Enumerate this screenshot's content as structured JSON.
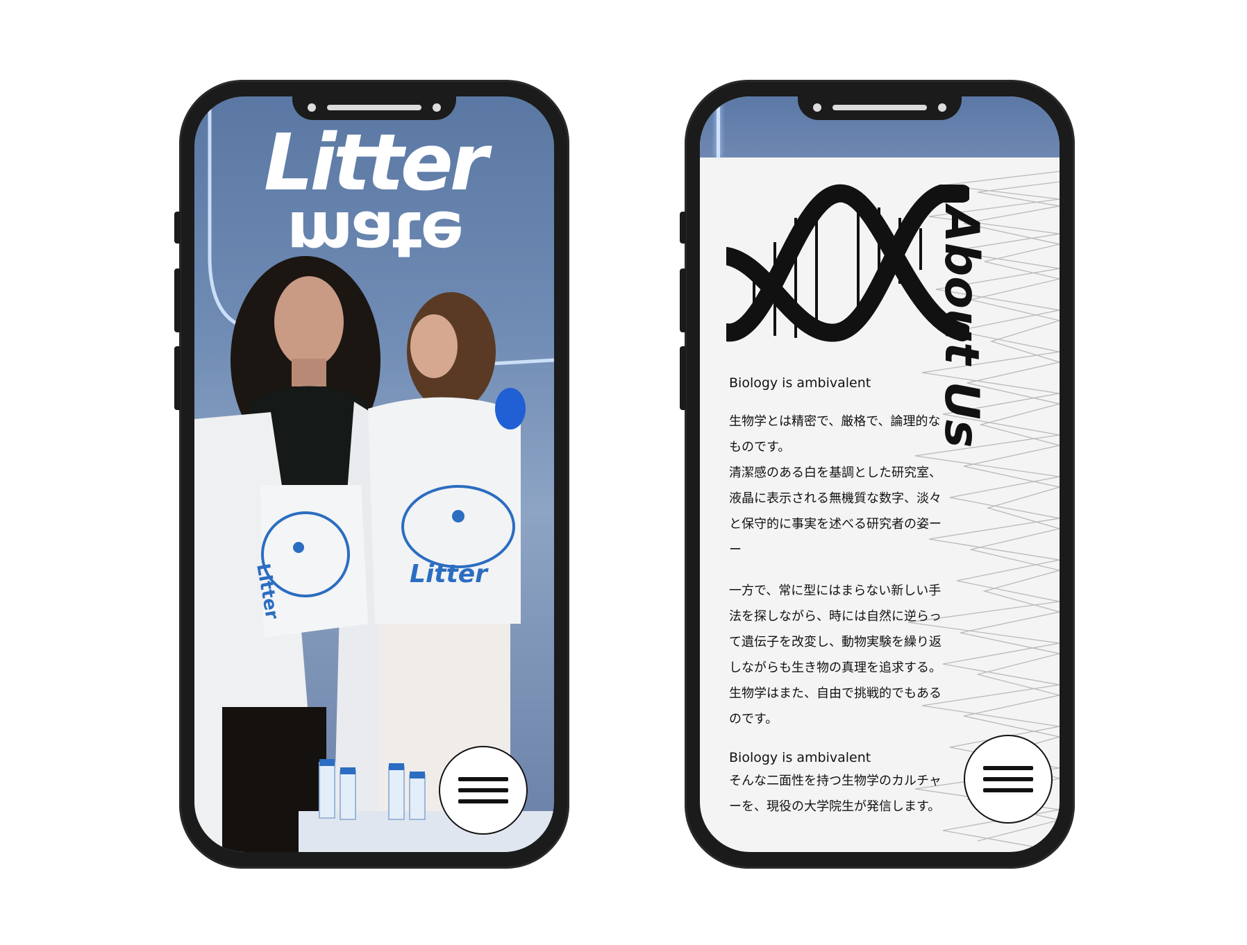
{
  "left_screen": {
    "logo_top": "Litter",
    "logo_bottom": "mate",
    "menu_icon": "hamburger-menu-icon"
  },
  "right_screen": {
    "title": "About Us",
    "tagline": "Biology is ambivalent",
    "paragraph1": [
      "生物学とは精密で、厳格で、論理的な",
      "ものです。",
      "清潔感のある白を基調とした研究室、",
      "液晶に表示される無機質な数字、淡々",
      "と保守的に事実を述べる研究者の姿ー",
      "ー"
    ],
    "paragraph2": [
      "一方で、常に型にはまらない新しい手",
      "法を探しながら、時には自然に逆らっ",
      "て遺伝子を改変し、動物実験を繰り返",
      "しながらも生き物の真理を追求する。",
      "生物学はまた、自由で挑戦的でもある",
      "のです。"
    ],
    "tagline2": "Biology is ambivalent",
    "paragraph3": [
      "そんな二面性を持つ生物学のカルチャ",
      "ーを、現役の大学院生が発信します。"
    ],
    "dna_icon": "dna-helix-icon",
    "menu_icon": "hamburger-menu-icon"
  },
  "colors": {
    "frame": "#1b1b1b",
    "photo_blue": "#6f8bb4",
    "about_bg": "#f4f4f4",
    "text": "#111111"
  }
}
